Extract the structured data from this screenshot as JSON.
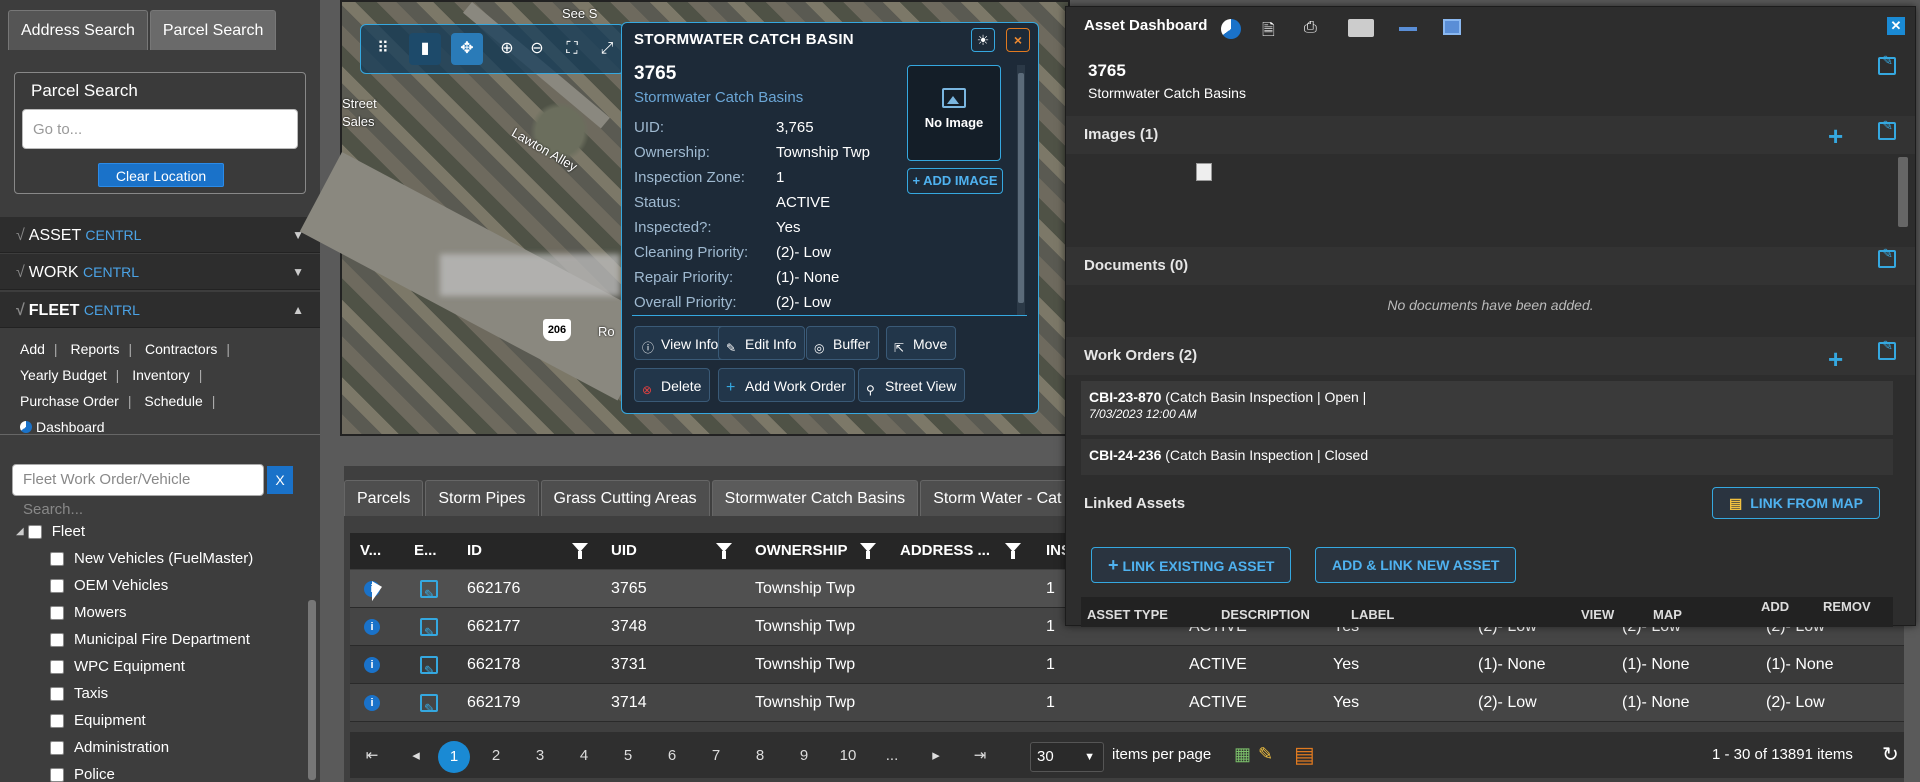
{
  "left_panel": {
    "tabs": [
      "Address Search",
      "Parcel Search"
    ],
    "parcel_title": "Parcel Search",
    "goto_placeholder": "Go to...",
    "clear_label": "Clear Location",
    "asset": {
      "label": "ASSET",
      "suffix": "CENTRL"
    },
    "work": {
      "label": "WORK",
      "suffix": "CENTRL"
    },
    "fleet": {
      "label": "FLEET",
      "suffix": "CENTRL"
    },
    "fleet_links": [
      "Add",
      "Reports",
      "Contractors",
      "Yearly Budget",
      "Inventory",
      "Purchase Order",
      "Schedule"
    ],
    "dashboard_label": "Dashboard",
    "search_placeholder": "Fleet Work Order/Vehicle Search...",
    "search_btn": "X",
    "tree_root": "Fleet",
    "tree_items": [
      "New Vehicles (FuelMaster)",
      "OEM Vehicles",
      "Mowers",
      "Municipal Fire Department",
      "WPC Equipment",
      "Taxis",
      "Equipment",
      "Administration",
      "Police"
    ]
  },
  "map": {
    "labels": {
      "street": "Street",
      "sales": "Sales",
      "lawton": "Lawton Alley",
      "ro": "Ro",
      "see": "See S"
    },
    "shield": "206"
  },
  "popup": {
    "title": "STORMWATER CATCH BASIN",
    "id": "3765",
    "subtitle": "Stormwater Catch Basins",
    "fields": [
      {
        "k": "UID:",
        "v": "3,765"
      },
      {
        "k": "Ownership:",
        "v": "Township Twp"
      },
      {
        "k": "Inspection Zone:",
        "v": "1"
      },
      {
        "k": "Status:",
        "v": "ACTIVE"
      },
      {
        "k": "Inspected?:",
        "v": "Yes"
      },
      {
        "k": "Cleaning Priority:",
        "v": "(2)- Low"
      },
      {
        "k": "Repair Priority:",
        "v": "(1)- None"
      },
      {
        "k": "Overall Priority:",
        "v": "(2)- Low"
      }
    ],
    "no_image": "No Image",
    "add_image": "+ ADD IMAGE",
    "buttons": [
      "View Info",
      "Edit Info",
      "Buffer",
      "Move",
      "Delete",
      "Add Work Order",
      "Street View"
    ]
  },
  "grid": {
    "tabs": [
      "Parcels",
      "Storm Pipes",
      "Grass Cutting Areas",
      "Stormwater Catch Basins",
      "Storm Water - Cat"
    ],
    "columns": [
      "V...",
      "E...",
      "ID",
      "UID",
      "OWNERSHIP",
      "ADDRESS ...",
      "INS"
    ],
    "rows": [
      {
        "id": "662176",
        "uid": "3765",
        "own": "Township Twp",
        "ins": "1",
        "status": "",
        "insp": "",
        "p1": "",
        "p2": "",
        "p3": ""
      },
      {
        "id": "662177",
        "uid": "3748",
        "own": "Township Twp",
        "ins": "1",
        "status": "ACTIVE",
        "insp": "Yes",
        "p1": "(2)- Low",
        "p2": "(2)- Low",
        "p3": "(2)- Low"
      },
      {
        "id": "662178",
        "uid": "3731",
        "own": "Township Twp",
        "ins": "1",
        "status": "ACTIVE",
        "insp": "Yes",
        "p1": "(1)- None",
        "p2": "(1)- None",
        "p3": "(1)- None"
      },
      {
        "id": "662179",
        "uid": "3714",
        "own": "Township Twp",
        "ins": "1",
        "status": "ACTIVE",
        "insp": "Yes",
        "p1": "(2)- Low",
        "p2": "(1)- None",
        "p3": "(2)- Low"
      }
    ],
    "pages": [
      "1",
      "2",
      "3",
      "4",
      "5",
      "6",
      "7",
      "8",
      "9",
      "10",
      "..."
    ],
    "current_page": "1",
    "per_page": "30",
    "per_page_label": "items per page",
    "range_text": "1 - 30 of 13891 items"
  },
  "dashboard": {
    "title": "Asset Dashboard",
    "asset_id": "3765",
    "asset_type": "Stormwater Catch Basins",
    "images_header": "Images (1)",
    "documents_header": "Documents (0)",
    "no_docs": "No documents have been added.",
    "work_orders_header": "Work Orders (2)",
    "wo1_code": "CBI-23-870",
    "wo1_text": " (Catch Basin Inspection | Open |",
    "wo1_date": "7/03/2023 12:00 AM",
    "wo2_code": "CBI-24-236",
    "wo2_text": " (Catch Basin Inspection | Closed",
    "linked_header": "Linked Assets",
    "link_from_map": "LINK FROM MAP",
    "link_existing": "LINK EXISTING ASSET",
    "add_link_new": "ADD & LINK NEW ASSET",
    "la_columns": [
      "ASSET TYPE",
      "DESCRIPTION",
      "LABEL",
      "VIEW",
      "MAP",
      "ADD",
      "REMOV"
    ]
  }
}
